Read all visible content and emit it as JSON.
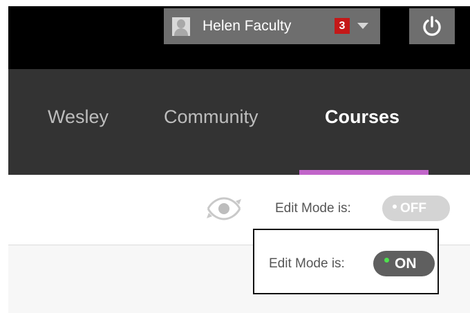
{
  "header": {
    "user_name": "Helen Faculty",
    "notification_count": "3",
    "avatar_icon": "user-avatar-icon",
    "menu_icon": "chevron-down-icon",
    "logout_icon": "power-icon",
    "badge_color": "#c41818"
  },
  "nav": {
    "tabs": [
      {
        "label": "Wesley",
        "active": false
      },
      {
        "label": "Community",
        "active": false
      },
      {
        "label": "Courses",
        "active": true
      }
    ],
    "active_indicator_color": "#c165c9"
  },
  "toolbar": {
    "student_preview_icon": "student-preview-icon",
    "edit_mode_label": "Edit Mode is:",
    "edit_mode_state": "OFF"
  },
  "highlight": {
    "edit_mode_label": "Edit Mode is:",
    "edit_mode_state": "ON",
    "on_indicator_color": "#4ee14e"
  }
}
